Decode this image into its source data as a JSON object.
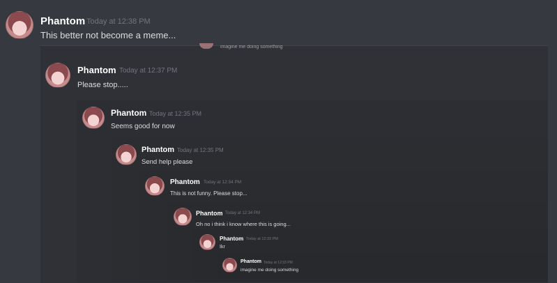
{
  "messages": [
    {
      "author": "Phantom",
      "time": "Today at 12:38 PM",
      "text": "This better not become a meme..."
    },
    {
      "author": "Phantom",
      "time": "Today at 12:37 PM",
      "text": "Please stop....."
    },
    {
      "author": "Phantom",
      "time": "Today at 12:35 PM",
      "text": "Seems good for now"
    },
    {
      "author": "Phantom",
      "time": "Today at 12:35 PM",
      "text": "Send help please"
    },
    {
      "author": "Phantom",
      "time": "Today at 12:34 PM",
      "text": "This is not funny. Please stop..."
    },
    {
      "author": "Phantom",
      "time": "Today at 12:34 PM",
      "text": "Oh no i think i know where this is going..."
    },
    {
      "author": "Phantom",
      "time": "Today at 12:33 PM",
      "text": "Ikr"
    },
    {
      "author": "Phantom",
      "time": "Today at 12:33 PM",
      "text": "imagine me doing something"
    }
  ],
  "cut_off_text": "imagine me doing something"
}
